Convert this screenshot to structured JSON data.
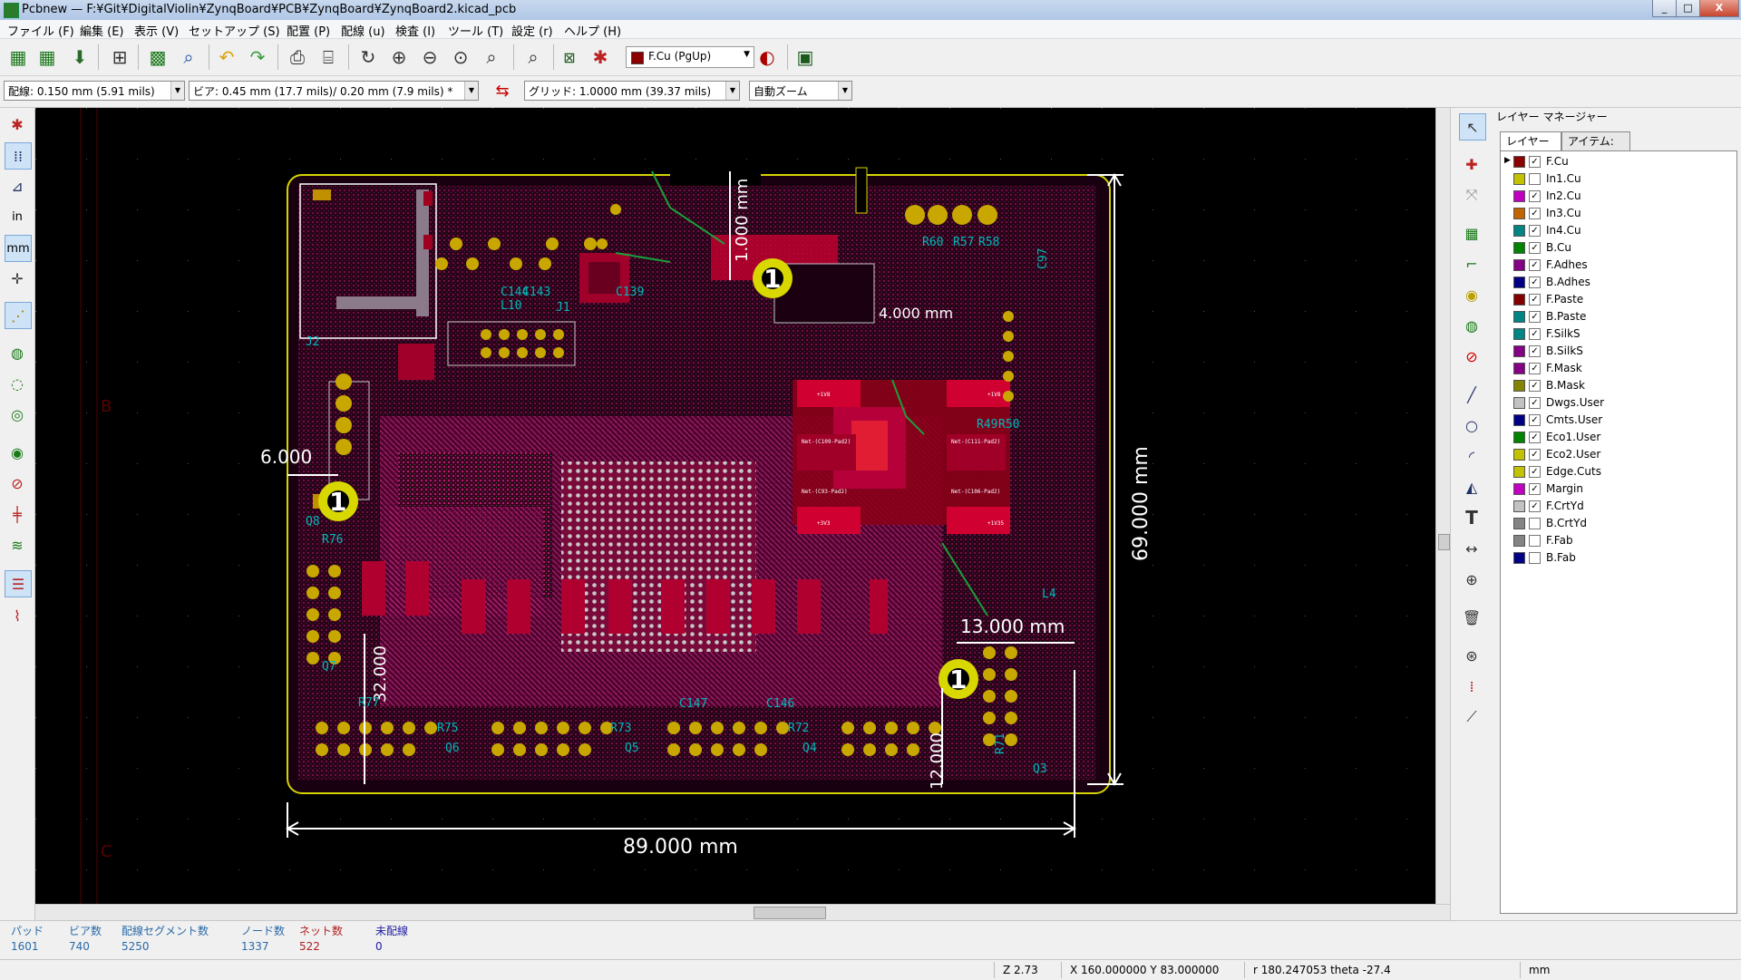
{
  "window": {
    "title": "Pcbnew — F:¥Git¥DigitalViolin¥ZynqBoard¥PCB¥ZynqBoard¥ZynqBoard2.kicad_pcb",
    "minimize": "_",
    "maximize": "□",
    "close": "X"
  },
  "menu": {
    "items": [
      "ファイル (F)",
      "編集 (E)",
      "表示 (V)",
      "セットアップ (S)",
      "配置 (P)",
      "配線 (u)",
      "検査 (I)",
      "ツール (T)",
      "設定 (r)",
      "ヘルプ (H)"
    ]
  },
  "toolbar": {
    "active_layer": "F.Cu (PgUp)"
  },
  "options": {
    "track": "配線: 0.150 mm (5.91 mils)",
    "via": "ビア: 0.45 mm (17.7 mils)/ 0.20 mm (7.9 mils) *",
    "grid": "グリッド: 1.0000 mm (39.37 mils)",
    "zoom": "自動ズーム"
  },
  "left_toolbar": {
    "units_in": "in",
    "units_mm": "mm"
  },
  "canvas": {
    "sheet_marks": [
      "B",
      "C"
    ],
    "dimensions": {
      "width": "89.000 mm",
      "height": "69.000 mm",
      "d6": "6.000",
      "d13": "13.000 mm",
      "d12": "12.000",
      "d32": "32.000",
      "d4": "4.000 mm",
      "d10": "1.000 mm"
    },
    "mount_hole_label": "1",
    "refs": {
      "J1": "J1",
      "J2": "J2",
      "Q3": "Q3",
      "Q4": "Q4",
      "Q5": "Q5",
      "Q6": "Q6",
      "Q7": "Q7",
      "Q8": "Q8",
      "R71": "R71",
      "R72": "R72",
      "R73": "R73",
      "R75": "R75",
      "R76": "R76",
      "R77": "R77",
      "R49": "R49",
      "R50": "R50",
      "R57": "R57",
      "R58": "R58",
      "R60": "R60",
      "C97": "C97",
      "C139": "C139",
      "C143": "C143",
      "C144": "C144",
      "C146": "C146",
      "C147": "C147",
      "L4": "L4",
      "L10": "L10",
      "net1": "Net-(C109-Pad2)",
      "net2": "Net-(C93-Pad2)",
      "net3": "Net-(C111-Pad2)",
      "net4": "Net-(C106-Pad2)",
      "p1v8": "+1V8",
      "p3v3": "+3V3",
      "p1v35": "+1V35"
    }
  },
  "layer_manager": {
    "title": "レイヤー マネージャー",
    "tabs": [
      "レイヤー",
      "アイテム:"
    ],
    "check_mark": "✓",
    "current_marker": "▶",
    "layers": [
      {
        "name": "F.Cu",
        "color": "#8B0000",
        "checked": true
      },
      {
        "name": "In1.Cu",
        "color": "#C2C200",
        "checked": false
      },
      {
        "name": "In2.Cu",
        "color": "#C200C2",
        "checked": true
      },
      {
        "name": "In3.Cu",
        "color": "#C26400",
        "checked": true
      },
      {
        "name": "In4.Cu",
        "color": "#008484",
        "checked": true
      },
      {
        "name": "B.Cu",
        "color": "#008400",
        "checked": true
      },
      {
        "name": "F.Adhes",
        "color": "#840084",
        "checked": true
      },
      {
        "name": "B.Adhes",
        "color": "#000084",
        "checked": true
      },
      {
        "name": "F.Paste",
        "color": "#840000",
        "checked": true
      },
      {
        "name": "B.Paste",
        "color": "#008484",
        "checked": true
      },
      {
        "name": "F.SilkS",
        "color": "#008484",
        "checked": true
      },
      {
        "name": "B.SilkS",
        "color": "#840084",
        "checked": true
      },
      {
        "name": "F.Mask",
        "color": "#840084",
        "checked": true
      },
      {
        "name": "B.Mask",
        "color": "#848400",
        "checked": true
      },
      {
        "name": "Dwgs.User",
        "color": "#C2C2C2",
        "checked": true
      },
      {
        "name": "Cmts.User",
        "color": "#000084",
        "checked": true
      },
      {
        "name": "Eco1.User",
        "color": "#008400",
        "checked": true
      },
      {
        "name": "Eco2.User",
        "color": "#C2C200",
        "checked": true
      },
      {
        "name": "Edge.Cuts",
        "color": "#C2C200",
        "checked": true
      },
      {
        "name": "Margin",
        "color": "#C200C2",
        "checked": true
      },
      {
        "name": "F.CrtYd",
        "color": "#C2C2C2",
        "checked": true
      },
      {
        "name": "B.CrtYd",
        "color": "#848484",
        "checked": false
      },
      {
        "name": "F.Fab",
        "color": "#848484",
        "checked": false
      },
      {
        "name": "B.Fab",
        "color": "#000084",
        "checked": false
      }
    ]
  },
  "message_panel": {
    "pads": {
      "label": "パッド",
      "value": "1601"
    },
    "vias": {
      "label": "ビア数",
      "value": "740"
    },
    "segments": {
      "label": "配線セグメント数",
      "value": "5250"
    },
    "nodes": {
      "label": "ノード数",
      "value": "1337"
    },
    "nets": {
      "label": "ネット数",
      "value": "522"
    },
    "unrouted": {
      "label": "未配線",
      "value": "0"
    }
  },
  "status": {
    "zoom": "Z 2.73",
    "xy": "X 160.000000  Y 83.000000",
    "polar": "r 180.247053  theta -27.4",
    "units": "mm"
  }
}
